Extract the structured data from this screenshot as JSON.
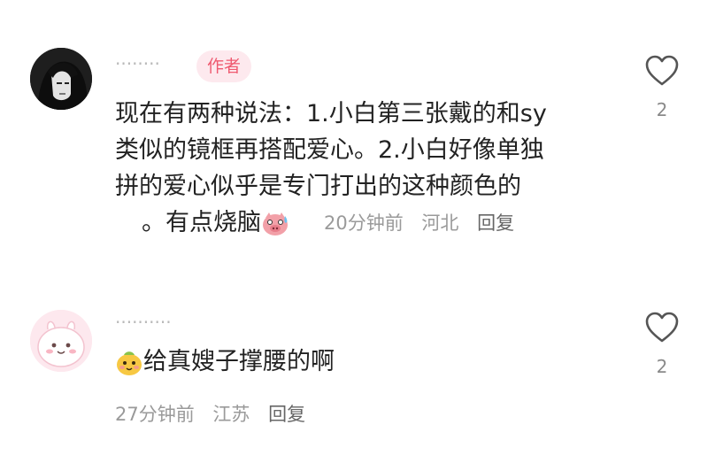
{
  "comments": [
    {
      "username": "········",
      "badge": "作者",
      "text_lines": [
        "现在有两种说法：1.小白第三张戴的和sy",
        "类似的镜框再搭配爱心。2.小白好像单独",
        "拼的爱心似乎是专门打出的这种颜色的",
        "。有点烧脑"
      ],
      "emoji": "sweating-pig-emoji",
      "time": "20分钟前",
      "location": "河北",
      "reply_label": "回复",
      "likes": "2"
    },
    {
      "username": "··········",
      "text": "给真嫂子撑腰的啊",
      "emoji": "yellow-cute-emoji",
      "time": "27分钟前",
      "location": "江苏",
      "reply_label": "回复",
      "likes": "2"
    }
  ],
  "icons": {
    "like": "heart-outline-icon"
  },
  "colors": {
    "badge_bg": "#fde9ee",
    "badge_text": "#ef5a70",
    "meta_text": "#9a9a9a",
    "content_text": "#222222"
  }
}
